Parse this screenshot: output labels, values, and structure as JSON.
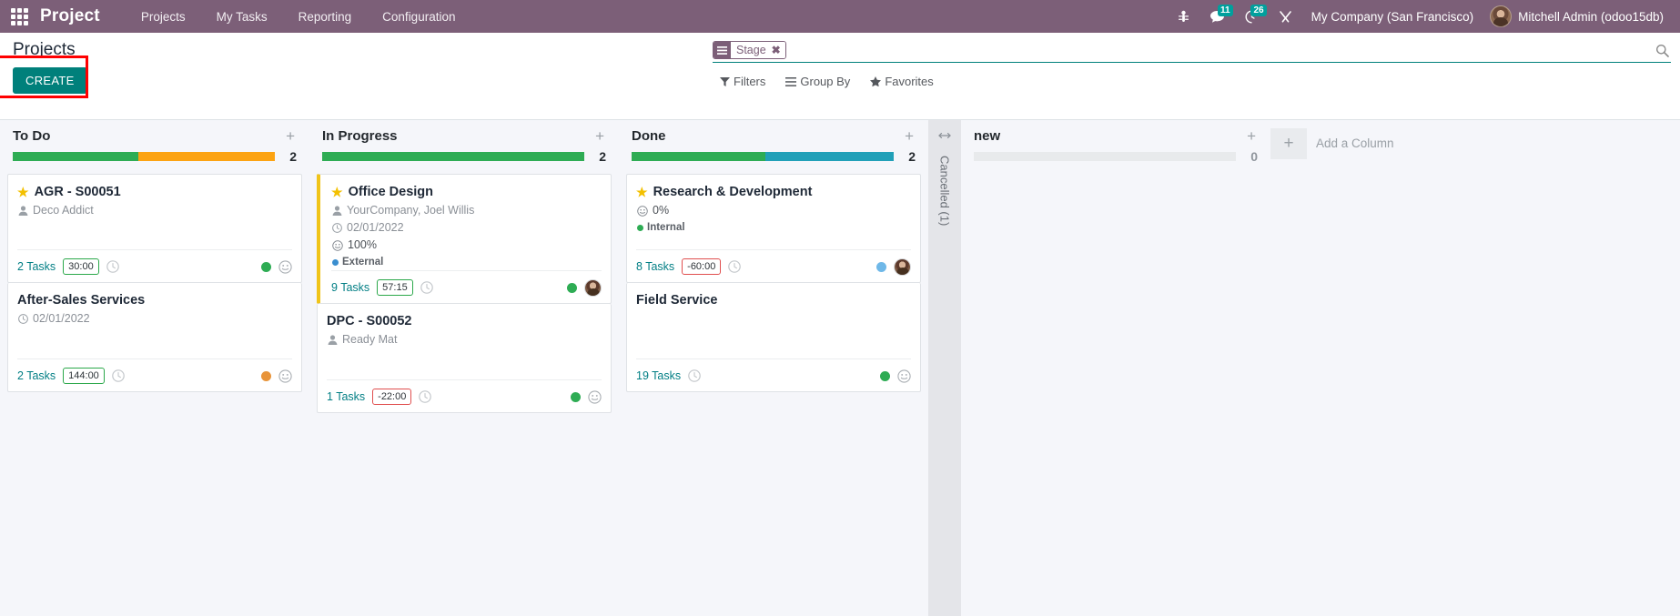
{
  "navbar": {
    "apps_icon": "apps-grid-icon",
    "brand": "Project",
    "menu": [
      {
        "label": "Projects"
      },
      {
        "label": "My Tasks"
      },
      {
        "label": "Reporting"
      },
      {
        "label": "Configuration"
      }
    ],
    "sys_icons": [
      {
        "name": "bug-icon",
        "badge": ""
      },
      {
        "name": "messages-icon",
        "badge": "11"
      },
      {
        "name": "activities-icon",
        "badge": "26"
      },
      {
        "name": "tools-icon",
        "badge": ""
      }
    ],
    "company": "My Company (San Francisco)",
    "user": "Mitchell Admin (odoo15db)"
  },
  "control_panel": {
    "title": "Projects",
    "create_label": "CREATE",
    "search": {
      "facet_label": "Stage",
      "facet_remove": "✖",
      "placeholder": "",
      "value": ""
    },
    "filters": [
      {
        "name": "filters",
        "label": "Filters",
        "icon": "funnel-icon"
      },
      {
        "name": "group-by",
        "label": "Group By",
        "icon": "bars-icon"
      },
      {
        "name": "favorites",
        "label": "Favorites",
        "icon": "star-icon"
      }
    ]
  },
  "kanban": {
    "columns": [
      {
        "id": "todo",
        "title": "To Do",
        "count": "2",
        "progress": [
          {
            "color": "#2eac54",
            "width": "48%"
          },
          {
            "color": "#fca312",
            "width": "52%"
          }
        ],
        "cards": [
          {
            "title": "AGR - S00051",
            "starred": true,
            "accent": false,
            "customer": "Deco Addict",
            "date": "",
            "percent": "",
            "tag": "",
            "tag_color": "",
            "tasks": "2 Tasks",
            "time": "30:00",
            "time_negative": false,
            "dot_color": "#2eac54",
            "has_smiley": true,
            "avatar": ""
          },
          {
            "title": "After-Sales Services",
            "starred": false,
            "accent": false,
            "customer": "",
            "date": "02/01/2022",
            "percent": "",
            "tag": "",
            "tag_color": "",
            "tasks": "2 Tasks",
            "time": "144:00",
            "time_negative": false,
            "dot_color": "#e8943a",
            "has_smiley": true,
            "avatar": ""
          }
        ]
      },
      {
        "id": "inprogress",
        "title": "In Progress",
        "count": "2",
        "progress": [
          {
            "color": "#2eac54",
            "width": "100%"
          }
        ],
        "cards": [
          {
            "title": "Office Design",
            "starred": true,
            "accent": true,
            "customer": "YourCompany, Joel Willis",
            "date": "02/01/2022",
            "percent": "100%",
            "tag": "External",
            "tag_color": "#3a8ecf",
            "tasks": "9 Tasks",
            "time": "57:15",
            "time_negative": false,
            "dot_color": "#2eac54",
            "has_smiley": false,
            "avatar": "brown"
          },
          {
            "title": "DPC - S00052",
            "starred": false,
            "accent": false,
            "customer": "Ready Mat",
            "date": "",
            "percent": "",
            "tag": "",
            "tag_color": "",
            "tasks": "1 Tasks",
            "time": "-22:00",
            "time_negative": true,
            "dot_color": "#2eac54",
            "has_smiley": true,
            "avatar": ""
          }
        ]
      },
      {
        "id": "done",
        "title": "Done",
        "count": "2",
        "progress": [
          {
            "color": "#2eac54",
            "width": "51%"
          },
          {
            "color": "#21a0b8",
            "width": "49%"
          }
        ],
        "cards": [
          {
            "title": "Research & Development",
            "starred": true,
            "accent": false,
            "customer": "",
            "date": "",
            "percent": "0%",
            "tag": "Internal",
            "tag_color": "#2eac54",
            "tasks": "8 Tasks",
            "time": "-60:00",
            "time_negative": true,
            "dot_color": "#6fb8e8",
            "has_smiley": false,
            "avatar": "brown"
          },
          {
            "title": "Field Service",
            "starred": false,
            "accent": false,
            "customer": "",
            "date": "",
            "percent": "",
            "tag": "",
            "tag_color": "",
            "tasks": "19 Tasks",
            "time": "",
            "time_negative": false,
            "dot_color": "#2eac54",
            "has_smiley": true,
            "avatar": ""
          }
        ]
      }
    ],
    "folded_column": {
      "label": "Cancelled (1)",
      "toggle_icon": "expand-icon"
    },
    "new_column": {
      "title": "new",
      "count": "0"
    },
    "add_column": {
      "label": "Add a Column",
      "plus": "+"
    }
  }
}
